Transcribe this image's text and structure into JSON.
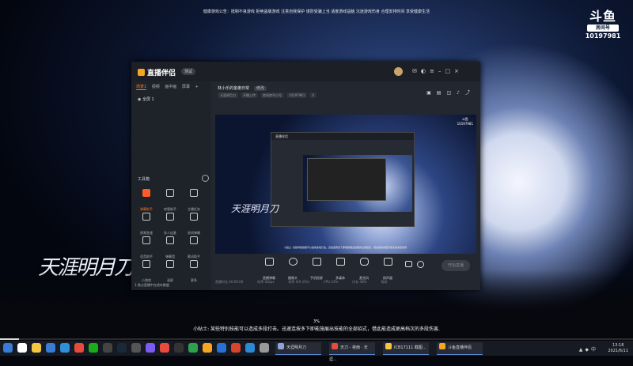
{
  "desktop": {
    "notice": "健康游戏公告：抵制不良游戏 拒绝盗版游戏 注意自我保护 谨防受骗上当 适度游戏益脑 沉迷游戏伤身 合理安排时间 享受健康生活",
    "douyu_logo": "斗鱼",
    "room_label": "房间号",
    "room_number": "10197981",
    "calligraphy": "天涯明月刀",
    "progress_percent": "3%",
    "progress_value": 0.03,
    "tip": "小贴士: 某些特别技能可以造成多段打击。迅速连按多下即能施展出技能的全部招式，借此能造成更高档次的多段伤害."
  },
  "app": {
    "name": "直播伴侣",
    "version_badge": "测试",
    "sidebar": {
      "tabs": [
        {
          "label": "场景1"
        },
        {
          "label": "视频"
        },
        {
          "label": "画中画"
        },
        {
          "label": "屏幕"
        }
      ],
      "add_tab": "+",
      "scene_label": "全屏 1",
      "toolbox_title": "工具箱",
      "tools": [
        {
          "label": "弹幕助手"
        },
        {
          "label": "房管助手"
        },
        {
          "label": "主播任务"
        },
        {
          "label": "视频急速"
        },
        {
          "label": "多人连麦"
        },
        {
          "label": "房间弹幕"
        },
        {
          "label": "语音助手"
        },
        {
          "label": "弹幕墙"
        },
        {
          "label": "歌词助手"
        },
        {
          "label": "小游戏"
        },
        {
          "label": "录屏"
        },
        {
          "label": "更多"
        }
      ],
      "bottom_text": "1.焦点直播中在线年数据"
    },
    "room": {
      "title": "林小乐的金庸日常",
      "title_badge": "修改",
      "category": "天涯明月刀",
      "status": "开播上传",
      "room_id_label": "房间房号小号",
      "room_id": "10197981",
      "followers": "0"
    },
    "preview_tip": "小贴士: 某些特别技能可以造成多段打击。迅速连按多下即能施展出技能的全部招式，借此能造成更高档次的多段伤害.",
    "controls": [
      {
        "label": "直播弹幕"
      },
      {
        "label": "摄像头"
      },
      {
        "label": "手机投屏"
      },
      {
        "label": "多媒体"
      },
      {
        "label": "麦克风"
      },
      {
        "label": "扬声器"
      }
    ],
    "start_button": "开始直播",
    "status_bar": [
      {
        "text": "直播时长 00:00:00"
      },
      {
        "text": "码率 0kbps"
      },
      {
        "text": "帧率 0/0 (0%)"
      },
      {
        "text": "CPU 43%"
      },
      {
        "text": "内存 48%"
      },
      {
        "text": "帮助"
      }
    ]
  },
  "taskbar": {
    "tasks": [
      {
        "label": "天涯明月刀"
      },
      {
        "label": "天刀 - 夜雨 · 天涯..."
      },
      {
        "label": "ICB17111 截图..."
      },
      {
        "label": "斗鱼直播伴侣"
      }
    ],
    "time": "13:18",
    "date": "2021/6/11"
  },
  "colors": {
    "accent": "#ff7a1a",
    "taskbar": "#161a22"
  }
}
